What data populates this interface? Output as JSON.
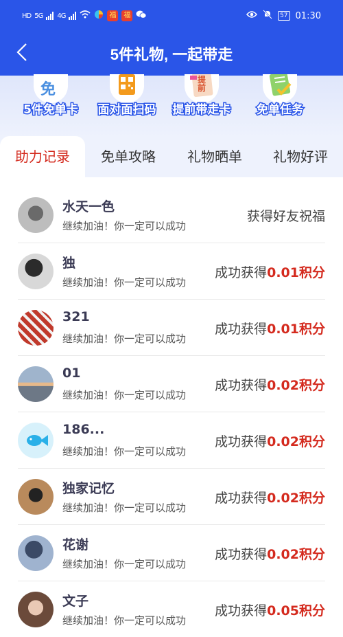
{
  "status_bar": {
    "left_indicators": [
      "HD",
      "5G",
      "4G"
    ],
    "time": "01:30",
    "battery": "57"
  },
  "header": {
    "title": "5件礼物, 一起带走"
  },
  "features": [
    {
      "label": "5件免单卡",
      "icon": "free-card-icon",
      "glyph": "免"
    },
    {
      "label": "面对面扫码",
      "icon": "qr-code-icon",
      "glyph": ""
    },
    {
      "label": "提前带走卡",
      "icon": "early-pickup-icon",
      "glyph": "提前"
    },
    {
      "label": "免单任务",
      "icon": "task-checklist-icon",
      "glyph": ""
    }
  ],
  "tabs": [
    {
      "label": "助力记录",
      "active": true
    },
    {
      "label": "免单攻略",
      "active": false
    },
    {
      "label": "礼物晒单",
      "active": false
    },
    {
      "label": "礼物好评",
      "active": false
    }
  ],
  "records": [
    {
      "name": "水天一色",
      "message": "继续加油！你一定可以成功",
      "result_prefix": "获得好友祝福",
      "points": ""
    },
    {
      "name": "独",
      "message": "继续加油！你一定可以成功",
      "result_prefix": "成功获得",
      "points": "0.01积分"
    },
    {
      "name": "321",
      "message": "继续加油！你一定可以成功",
      "result_prefix": "成功获得",
      "points": "0.01积分"
    },
    {
      "name": "01",
      "message": "继续加油！你一定可以成功",
      "result_prefix": "成功获得",
      "points": "0.02积分"
    },
    {
      "name": "186...",
      "message": "继续加油！你一定可以成功",
      "result_prefix": "成功获得",
      "points": "0.02积分"
    },
    {
      "name": "独家记忆",
      "message": "继续加油！你一定可以成功",
      "result_prefix": "成功获得",
      "points": "0.02积分"
    },
    {
      "name": "花谢",
      "message": "继续加油！你一定可以成功",
      "result_prefix": "成功获得",
      "points": "0.02积分"
    },
    {
      "name": "文子",
      "message": "继续加油！你一定可以成功",
      "result_prefix": "成功获得",
      "points": "0.05积分"
    }
  ],
  "colors": {
    "brand_blue": "#2a55e8",
    "accent_red": "#d42a1e"
  }
}
